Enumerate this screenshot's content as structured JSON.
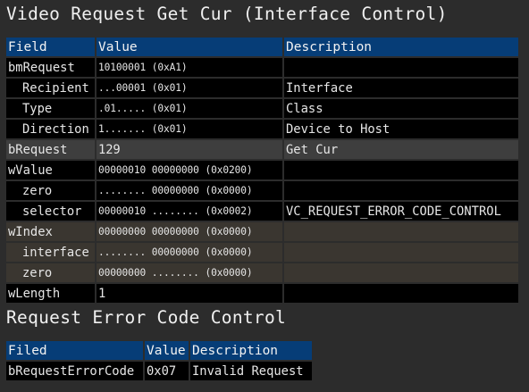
{
  "title": "Video Request Get Cur (Interface Control)",
  "main_table": {
    "headers": [
      "Field",
      "Value",
      "Description"
    ],
    "rows": [
      {
        "field": "bmRequest",
        "value": "10100001 (0xA1)",
        "desc": "",
        "indent": false,
        "style": "black"
      },
      {
        "field": "Recipient",
        "value": "...00001 (0x01)",
        "desc": "Interface",
        "indent": true,
        "style": "black"
      },
      {
        "field": "Type",
        "value": ".01..... (0x01)",
        "desc": "Class",
        "indent": true,
        "style": "black"
      },
      {
        "field": "Direction",
        "value": "1....... (0x01)",
        "desc": "Device to Host",
        "indent": true,
        "style": "black"
      },
      {
        "field": "bRequest",
        "value": "129",
        "desc": "Get Cur",
        "indent": false,
        "style": "gray",
        "big": true
      },
      {
        "field": "wValue",
        "value": "00000010 00000000 (0x0200)",
        "desc": "",
        "indent": false,
        "style": "black"
      },
      {
        "field": "zero",
        "value": "........ 00000000 (0x0000)",
        "desc": "",
        "indent": true,
        "style": "black"
      },
      {
        "field": "selector",
        "value": "00000010 ........ (0x0002)",
        "desc": "VC_REQUEST_ERROR_CODE_CONTROL",
        "indent": true,
        "style": "black"
      },
      {
        "field": "wIndex",
        "value": "00000000 00000000 (0x0000)",
        "desc": "",
        "indent": false,
        "style": "brown"
      },
      {
        "field": "interface",
        "value": "........ 00000000 (0x0000)",
        "desc": "",
        "indent": true,
        "style": "brown"
      },
      {
        "field": "zero",
        "value": "00000000 ........ (0x0000)",
        "desc": "",
        "indent": true,
        "style": "brown"
      },
      {
        "field": "wLength",
        "value": "1",
        "desc": "",
        "indent": false,
        "style": "black",
        "big": true
      }
    ]
  },
  "section2_title": "Request Error Code Control",
  "error_table": {
    "headers": [
      "Filed",
      "Value",
      "Description"
    ],
    "rows": [
      {
        "field": "bRequestErrorCode",
        "value": "0x07",
        "desc": "Invalid Request"
      }
    ]
  },
  "colors": {
    "background": "#2c2c2c",
    "header": "#063d77",
    "row_black": "#000000",
    "row_gray": "#3e3e3e",
    "row_brown": "#3a3630",
    "text": "#e6e6e6"
  }
}
